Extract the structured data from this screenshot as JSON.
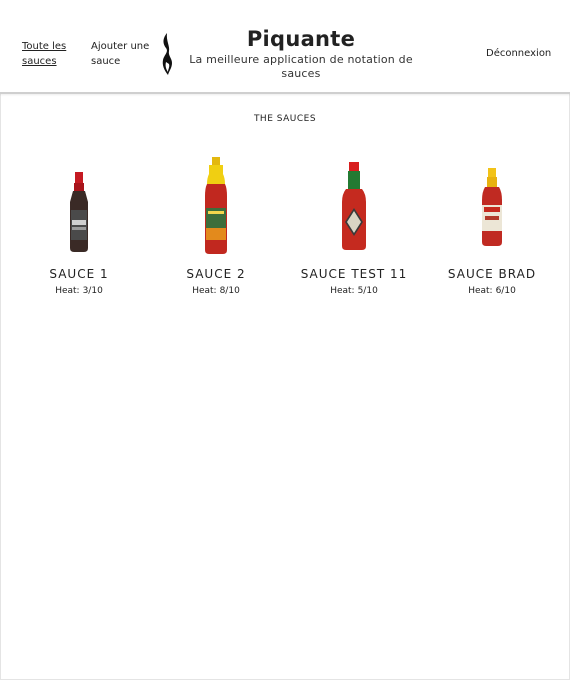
{
  "nav": {
    "all_sauces": "Toute les sauces",
    "add_sauce": "Ajouter une sauce",
    "logout": "Déconnexion"
  },
  "brand": {
    "title": "Piquante",
    "tagline": "La meilleure application de notation de sauces"
  },
  "section_title": "THE SAUCES",
  "sauces": [
    {
      "name": "SAUCE 1",
      "heat_label": "Heat:",
      "heat": "3/10"
    },
    {
      "name": "SAUCE 2",
      "heat_label": "Heat:",
      "heat": "8/10"
    },
    {
      "name": "SAUCE TEST 11",
      "heat_label": "Heat:",
      "heat": "5/10"
    },
    {
      "name": "SAUCE BRAD",
      "heat_label": "Heat:",
      "heat": "6/10"
    }
  ]
}
